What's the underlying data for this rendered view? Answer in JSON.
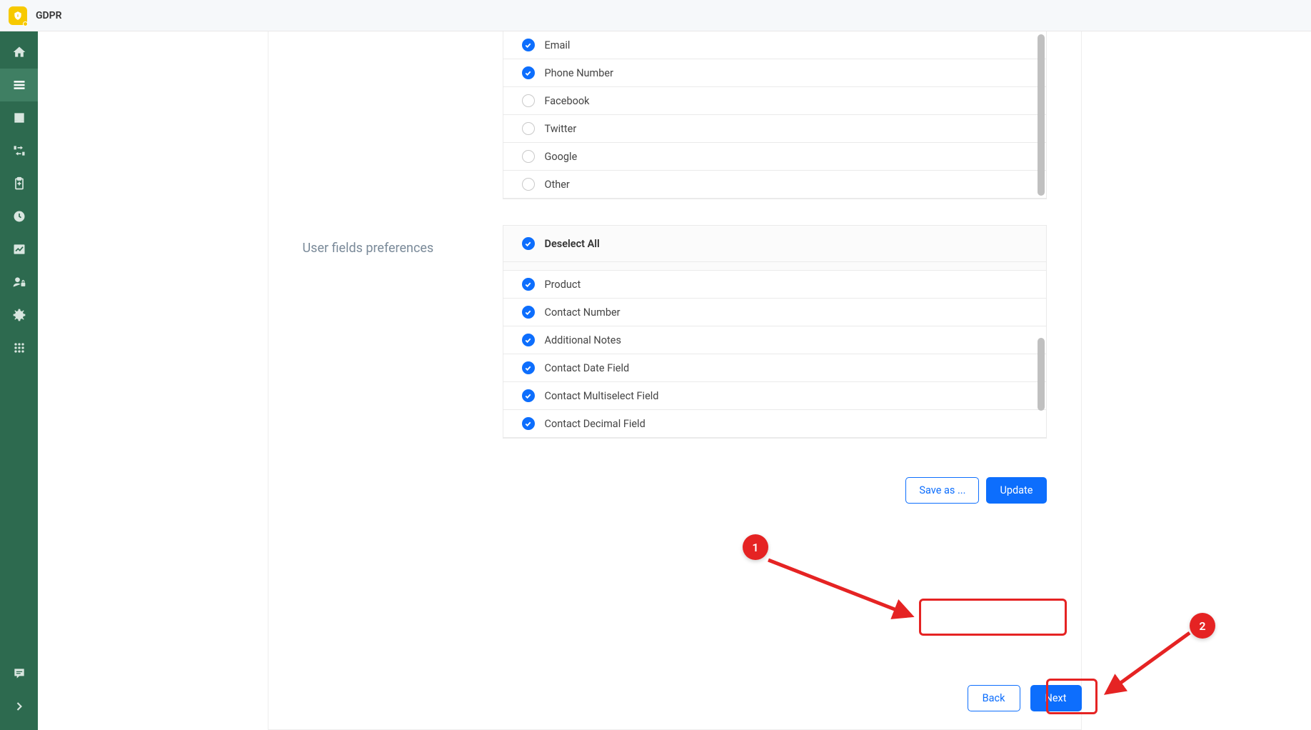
{
  "header": {
    "title": "GDPR"
  },
  "section1": {
    "label": "User fields preferences"
  },
  "contact_fields": [
    {
      "label": "Email",
      "checked": true
    },
    {
      "label": "Phone Number",
      "checked": true
    },
    {
      "label": "Facebook",
      "checked": false
    },
    {
      "label": "Twitter",
      "checked": false
    },
    {
      "label": "Google",
      "checked": false
    },
    {
      "label": "Other",
      "checked": false
    }
  ],
  "user_fields_header": {
    "label": "Deselect All",
    "checked": true
  },
  "user_fields": [
    {
      "label": "Product",
      "checked": true
    },
    {
      "label": "Contact Number",
      "checked": true
    },
    {
      "label": "Additional Notes",
      "checked": true
    },
    {
      "label": "Contact Date Field",
      "checked": true
    },
    {
      "label": "Contact Multiselect Field",
      "checked": true
    },
    {
      "label": "Contact Decimal Field",
      "checked": true
    }
  ],
  "actions": {
    "save_as": "Save as ...",
    "update": "Update"
  },
  "nav": {
    "back": "Back",
    "next": "Next"
  },
  "annotations": {
    "badge1": "1",
    "badge2": "2"
  }
}
